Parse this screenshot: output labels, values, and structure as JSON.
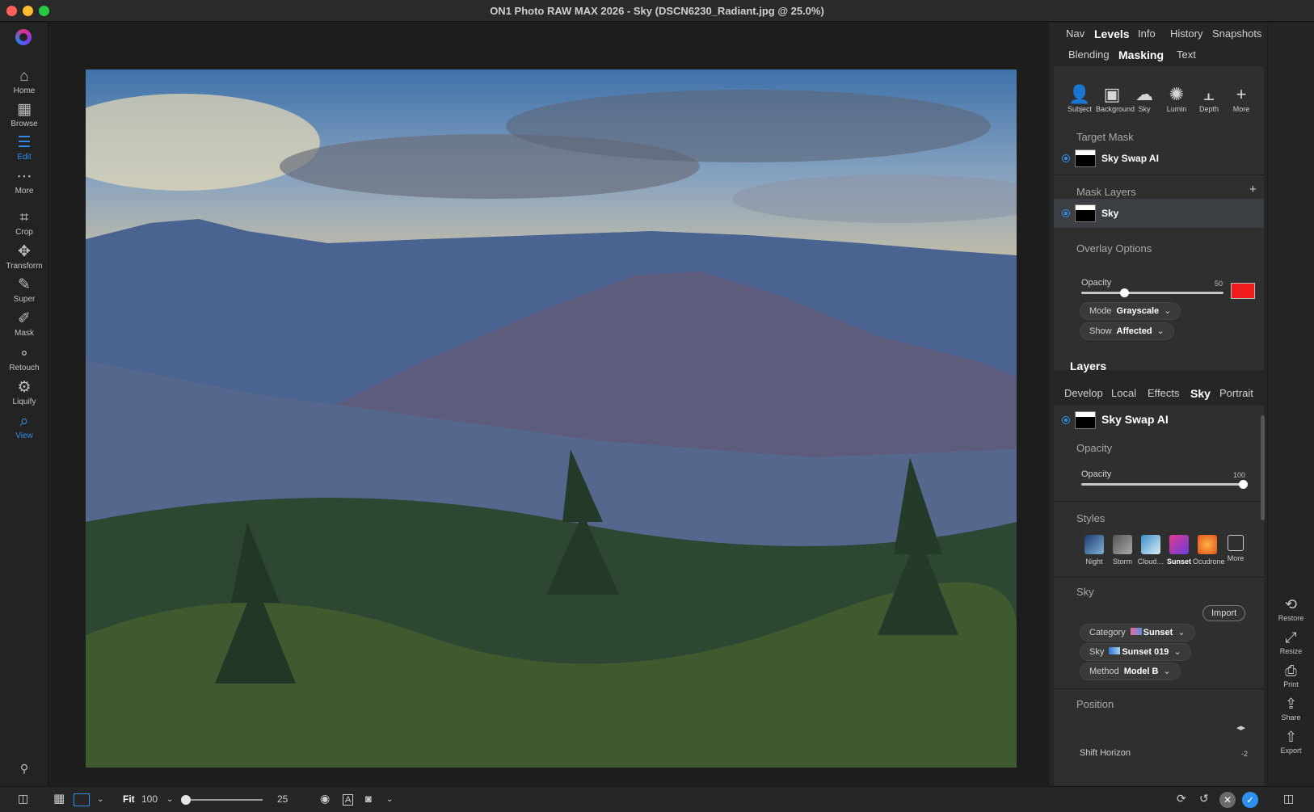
{
  "window": {
    "title": "ON1 Photo RAW MAX 2026 - Sky (DSCN6230_Radiant.jpg @ 25.0%)"
  },
  "left_tools": [
    {
      "label": "Home",
      "icon": "home-icon",
      "glyph": "⌂"
    },
    {
      "label": "Browse",
      "icon": "browse-icon",
      "glyph": "▦"
    },
    {
      "label": "Edit",
      "icon": "edit-icon",
      "glyph": "☰"
    },
    {
      "label": "More",
      "icon": "more-icon",
      "glyph": "⋯"
    },
    {
      "label": "Crop",
      "icon": "crop-icon",
      "glyph": "⌗"
    },
    {
      "label": "Transform",
      "icon": "transform-icon",
      "glyph": "✥"
    },
    {
      "label": "Super",
      "icon": "super-icon",
      "glyph": "✎"
    },
    {
      "label": "Mask",
      "icon": "mask-icon",
      "glyph": "✐"
    },
    {
      "label": "Retouch",
      "icon": "retouch-icon",
      "glyph": "∘"
    },
    {
      "label": "Liquify",
      "icon": "liquify-icon",
      "glyph": "⚙"
    },
    {
      "label": "View",
      "icon": "view-icon",
      "glyph": "⌕"
    }
  ],
  "panel_tabs_top": [
    "Nav",
    "Levels",
    "Info",
    "History",
    "Snapshots"
  ],
  "panel_tabs_second": [
    "Blending",
    "Masking",
    "Text"
  ],
  "mask_tools": [
    {
      "label": "Subject",
      "icon": "subject-icon",
      "glyph": "👤"
    },
    {
      "label": "Background",
      "icon": "background-icon",
      "glyph": "▣"
    },
    {
      "label": "Sky",
      "icon": "sky-icon",
      "glyph": "☁"
    },
    {
      "label": "Lumin",
      "icon": "lumin-icon",
      "glyph": "✺"
    },
    {
      "label": "Depth",
      "icon": "depth-icon",
      "glyph": "⫠"
    },
    {
      "label": "More",
      "icon": "plus-icon",
      "glyph": "+"
    }
  ],
  "target_mask": {
    "heading": "Target Mask",
    "name": "Sky Swap AI"
  },
  "mask_layers": {
    "heading": "Mask Layers",
    "add": "+",
    "items": [
      "Sky"
    ]
  },
  "overlay": {
    "heading": "Overlay Options",
    "opacity_label": "Opacity",
    "opacity_value": "50",
    "opacity_fraction": 0.3,
    "color": "#ee1c1c",
    "mode_label": "Mode",
    "mode_value": "Grayscale",
    "show_label": "Show",
    "show_value": "Affected"
  },
  "layers": {
    "heading": "Layers",
    "tabs": [
      "Develop",
      "Local",
      "Effects",
      "Sky",
      "Portrait"
    ],
    "active_tab": "Sky",
    "layer_name": "Sky Swap AI",
    "opacity_section": "Opacity",
    "opacity_label": "Opacity",
    "opacity_value": "100",
    "opacity_fraction": 1.0,
    "styles_heading": "Styles",
    "styles": [
      "Night",
      "Storm",
      "Cloud…",
      "Sunset",
      "Ocudrone",
      "More"
    ],
    "active_style": "Sunset",
    "sky_heading": "Sky",
    "import_label": "Import",
    "category_label": "Category",
    "category_value": "Sunset",
    "sky_label": "Sky",
    "sky_value": "Sunset 019",
    "method_label": "Method",
    "method_value": "Model B",
    "position_heading": "Position",
    "shift_horizon_label": "Shift Horizon",
    "shift_horizon_value": "-2"
  },
  "right_tools": [
    {
      "label": "Restore",
      "icon": "restore-icon",
      "glyph": "⟲"
    },
    {
      "label": "Resize",
      "icon": "resize-icon",
      "glyph": "⤢"
    },
    {
      "label": "Print",
      "icon": "print-icon",
      "glyph": "⎙"
    },
    {
      "label": "Share",
      "icon": "share-icon",
      "glyph": "⇪"
    },
    {
      "label": "Export",
      "icon": "export-icon",
      "glyph": "⇧"
    }
  ],
  "bottom": {
    "fit_label": "Fit",
    "zoom_value": "100",
    "slider_value": "25"
  },
  "colors": {
    "accent": "#2f8ff0",
    "overlay": "#ee1c1c"
  }
}
